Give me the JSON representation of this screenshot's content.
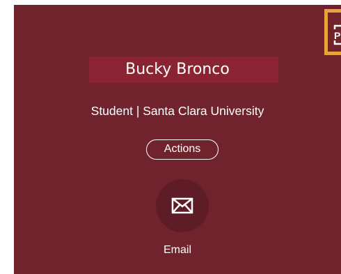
{
  "profile": {
    "name": "Bucky Bronco",
    "subtitle": "Student | Santa Clara University"
  },
  "buttons": {
    "actions_label": "Actions",
    "email_label": "Email",
    "pdf_label": "PDF"
  },
  "icons": {
    "pdf": "pdf-document-icon",
    "email": "envelope-icon"
  },
  "colors": {
    "background": "#71232d",
    "name_band": "#8a2432",
    "highlight": "#e8a33d",
    "email_circle": "#5e1d26"
  }
}
